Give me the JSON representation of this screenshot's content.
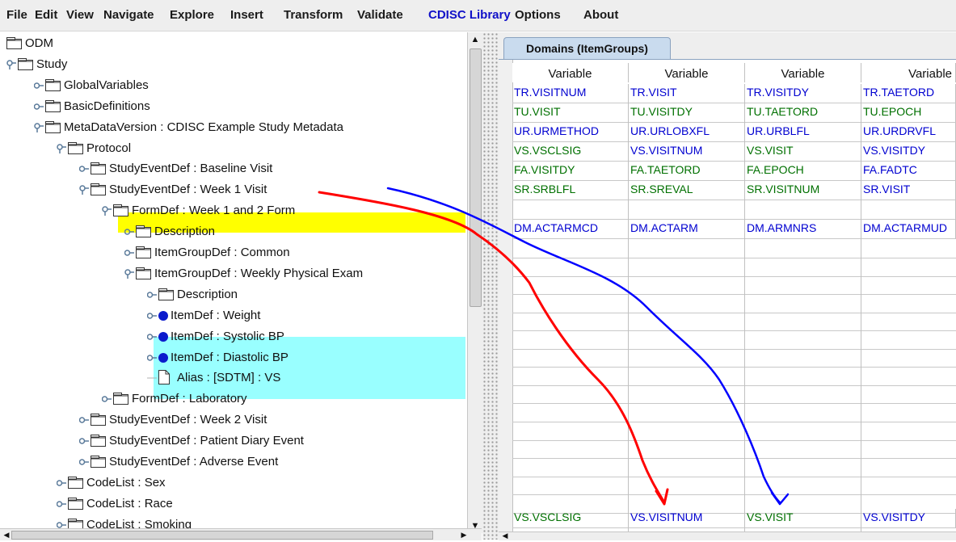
{
  "menu": [
    "File",
    "Edit",
    "View",
    "Navigate",
    "Explore",
    "Insert",
    "Transform",
    "Validate",
    "CDISC Library",
    "Options",
    "About"
  ],
  "tree": {
    "nodes": [
      {
        "label": "ODM"
      },
      {
        "label": "Study"
      },
      {
        "label": "GlobalVariables"
      },
      {
        "label": "BasicDefinitions"
      },
      {
        "label": "MetaDataVersion : CDISC Example Study Metadata"
      },
      {
        "label": "Protocol"
      },
      {
        "label": "StudyEventDef : Baseline Visit"
      },
      {
        "label": "StudyEventDef : Week 1 Visit"
      },
      {
        "label": "FormDef : Week 1 and 2 Form"
      },
      {
        "label": "Description"
      },
      {
        "label": "ItemGroupDef : Common"
      },
      {
        "label": "ItemGroupDef : Weekly Physical Exam"
      },
      {
        "label": "Description"
      },
      {
        "label": "ItemDef : Weight"
      },
      {
        "label": "ItemDef : Systolic BP"
      },
      {
        "label": "ItemDef : Diastolic BP"
      },
      {
        "label": "Alias : [SDTM] : VS"
      },
      {
        "label": "FormDef : Laboratory"
      },
      {
        "label": "StudyEventDef : Week 2 Visit"
      },
      {
        "label": "StudyEventDef : Patient Diary Event"
      },
      {
        "label": "StudyEventDef : Adverse Event"
      },
      {
        "label": "CodeList : Sex"
      },
      {
        "label": "CodeList : Race"
      },
      {
        "label": "CodeList : Smoking"
      }
    ]
  },
  "domains": {
    "tab_label": "Domains (ItemGroups)",
    "columns": [
      "Variable",
      "Variable",
      "Variable",
      "Variable"
    ],
    "rows": [
      [
        "TR.VISITNUM",
        "TR.VISIT",
        "TR.VISITDY",
        "TR.TAETORD"
      ],
      [
        "TU.VISIT",
        "TU.VISITDY",
        "TU.TAETORD",
        "TU.EPOCH"
      ],
      [
        "UR.URMETHOD",
        "UR.URLOBXFL",
        "UR.URBLFL",
        "UR.URDRVFL"
      ],
      [
        "VS.VSCLSIG",
        "VS.VISITNUM",
        "VS.VISIT",
        "VS.VISITDY"
      ],
      [
        "FA.VISITDY",
        "FA.TAETORD",
        "FA.EPOCH",
        "FA.FADTC"
      ],
      [
        "SR.SRBLFL",
        "SR.SREVAL",
        "SR.VISITNUM",
        "SR.VISIT"
      ],
      [
        "",
        "",
        "",
        ""
      ],
      [
        "DM.ACTARMCD",
        "DM.ACTARM",
        "DM.ARMNRS",
        "DM.ACTARMUD"
      ]
    ],
    "bottom_row": [
      "VS.VSCLSIG",
      "VS.VISITNUM",
      "VS.VISIT",
      "VS.VISITDY"
    ]
  },
  "colors": {
    "selection_highlight": "#ffff00",
    "items_highlight": "#99ffff",
    "arrow_red": "#ff0000",
    "arrow_blue": "#0000ff",
    "cell_text": "#0000d0",
    "cell_text_green": "#007000"
  }
}
